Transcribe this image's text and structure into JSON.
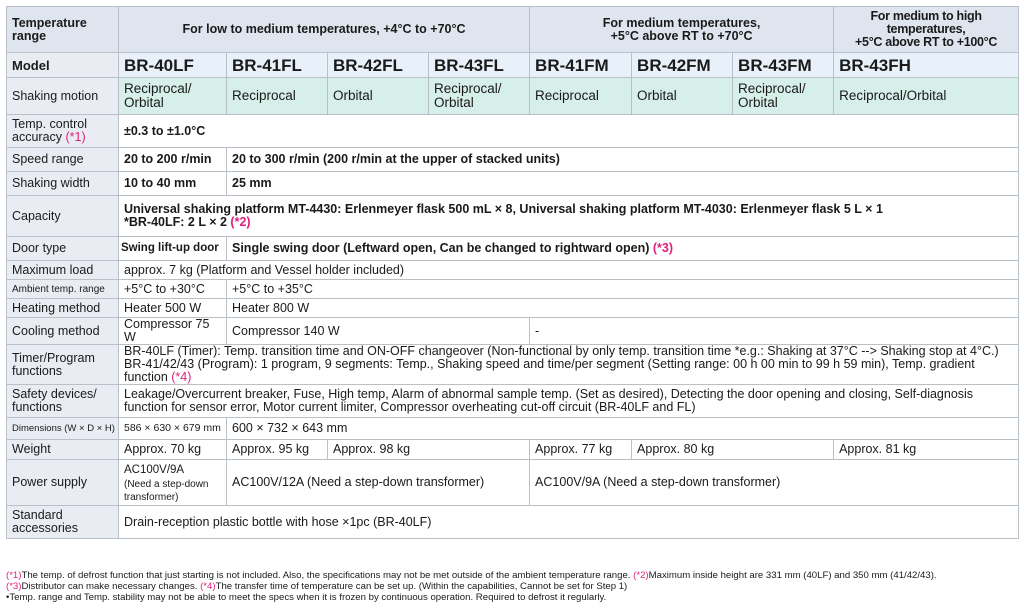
{
  "header": {
    "temp_range_label": "Temperature range",
    "low": "For low to medium temperatures, +4°C to +70°C",
    "medium_line1": "For medium temperatures,",
    "medium_line2": "+5°C above RT to +70°C",
    "high_line1": "For medium to high temperatures,",
    "high_line2": "+5°C above RT to +100°C"
  },
  "rows": {
    "model": {
      "label": "Model",
      "values": [
        "BR-40LF",
        "BR-41FL",
        "BR-42FL",
        "BR-43FL",
        "BR-41FM",
        "BR-42FM",
        "BR-43FM",
        "BR-43FH"
      ]
    },
    "shaking_motion": {
      "label": "Shaking motion",
      "values": [
        "Reciprocal/ Orbital",
        "Reciprocal",
        "Orbital",
        "Reciprocal/ Orbital",
        "Reciprocal",
        "Orbital",
        "Reciprocal/ Orbital",
        "Reciprocal/Orbital"
      ]
    },
    "temp_control": {
      "label": "Temp. control accuracy",
      "ref": "(*1)",
      "value": "±0.3 to ±1.0°C"
    },
    "speed_range": {
      "label": "Speed range",
      "v1": "20 to 200 r/min",
      "v2": "20 to 300 r/min (200 r/min at the upper of stacked units)"
    },
    "shaking_width": {
      "label": "Shaking width",
      "v1": "10 to 40 mm",
      "v2": "25 mm"
    },
    "capacity": {
      "label": "Capacity",
      "line1": "Universal shaking platform MT-4430: Erlenmeyer flask 500 mL × 8, Universal shaking platform MT-4030: Erlenmeyer flask 5 L × 1",
      "line2": "*BR-40LF: 2 L × 2",
      "ref": "(*2)"
    },
    "door_type": {
      "label": "Door type",
      "v1": "Swing lift-up door",
      "v2": "Single swing door (Leftward open, Can be changed to rightward open)",
      "ref": "(*3)"
    },
    "max_load": {
      "label": "Maximum load",
      "value": "approx. 7 kg (Platform and Vessel holder included)"
    },
    "ambient": {
      "label": "Ambient temp. range",
      "v1": "+5°C to +30°C",
      "v2": "+5°C to +35°C"
    },
    "heating": {
      "label": "Heating method",
      "v1": "Heater 500 W",
      "v2": "Heater 800 W"
    },
    "cooling": {
      "label": "Cooling method",
      "v1": "Compressor 75 W",
      "v2": "Compressor 140 W",
      "v3": "-"
    },
    "timer": {
      "label": "Timer/Program functions",
      "line1": "BR-40LF (Timer): Temp. transition time and ON-OFF changeover (Non-functional by only temp. transition time *e.g.: Shaking at 37°C --> Shaking stop at 4°C.)",
      "line2": "BR-41/42/43 (Program): 1 program, 9 segments: Temp., Shaking speed and time/per segment (Setting range: 00 h 00 min to 99 h 59 min), Temp. gradient function",
      "ref": "(*4)"
    },
    "safety": {
      "label": "Safety devices/ functions",
      "line1": "Leakage/Overcurrent breaker, Fuse, High temp, Alarm of abnormal sample temp. (Set as desired), Detecting the door opening and closing, Self-diagnosis",
      "line2": "function for sensor error, Motor current limiter, Compressor overheating cut-off circuit (BR-40LF and FL)"
    },
    "dimensions": {
      "label": "Dimensions (W × D × H)",
      "v1": "586 × 630 × 679 mm",
      "v2": "600 × 732 × 643 mm"
    },
    "weight": {
      "label": "Weight",
      "values": [
        "Approx. 70 kg",
        "Approx. 95 kg",
        "Approx. 98 kg",
        "Approx. 77 kg",
        "Approx. 80 kg",
        "Approx. 81 kg"
      ]
    },
    "power": {
      "label": "Power supply",
      "v1_line1": "AC100V/9A",
      "v1_line2": "(Need a step-down transformer)",
      "v2": "AC100V/12A (Need a step-down transformer)",
      "v3": "AC100V/9A (Need a step-down transformer)"
    },
    "accessories": {
      "label": "Standard accessories",
      "value": "Drain-reception plastic bottle with hose ×1pc (BR-40LF)"
    }
  },
  "footnotes": {
    "n1_ref": "(*1)",
    "n1": "The temp. of defrost function that just starting is not included. Also, the specifications may not be met outside of the ambient temperature range.",
    "n2_ref": "(*2)",
    "n2": "Maximum inside height are 331 mm (40LF) and 350 mm (41/42/43).",
    "n3_ref": "(*3)",
    "n3": "Distributor can make necessary changes.",
    "n4_ref": "(*4)",
    "n4": "The transfer time of temperature can be set up. (Within the capabilities, Cannot be set for Step 1)",
    "n5": "•Temp. range and Temp. stability may not be able to meet the specs when it is frozen by continuous operation. Required to defrost it regularly."
  }
}
